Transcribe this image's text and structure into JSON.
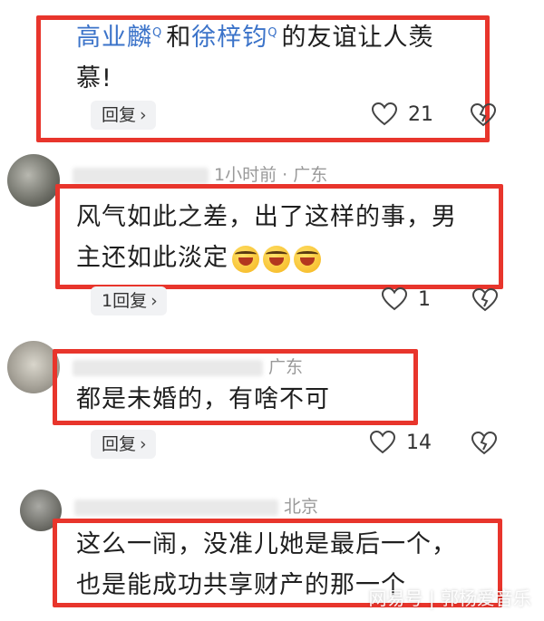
{
  "comments": [
    {
      "mention_1": "高业麟",
      "mention_sep": "和",
      "mention_2": "徐梓钧",
      "text_rest": "的友谊让人羡",
      "text_line2": "慕!",
      "reply_label": "回复",
      "likes": "21"
    },
    {
      "meta": "1小时前 · 广东",
      "text_line1": "风气如此之差，出了这样的事，男",
      "text_line2": "主还如此淡定",
      "emoji": "loudly-crying-face",
      "reply_label": "1回复",
      "likes": "1"
    },
    {
      "meta": "广东",
      "text_line1": "都是未婚的，有啥不可",
      "reply_label": "回复",
      "likes": "14"
    },
    {
      "meta": "北京",
      "text_line1": "这么一闹，没准儿她是最后一个，",
      "text_line2": "也是能成功共享财产的那一个"
    }
  ],
  "watermark": "网易号 | 郭杨爱音乐",
  "colors": {
    "highlight_box": "#e8352c",
    "mention_link": "#3b73c9",
    "meta_text": "#999999"
  }
}
